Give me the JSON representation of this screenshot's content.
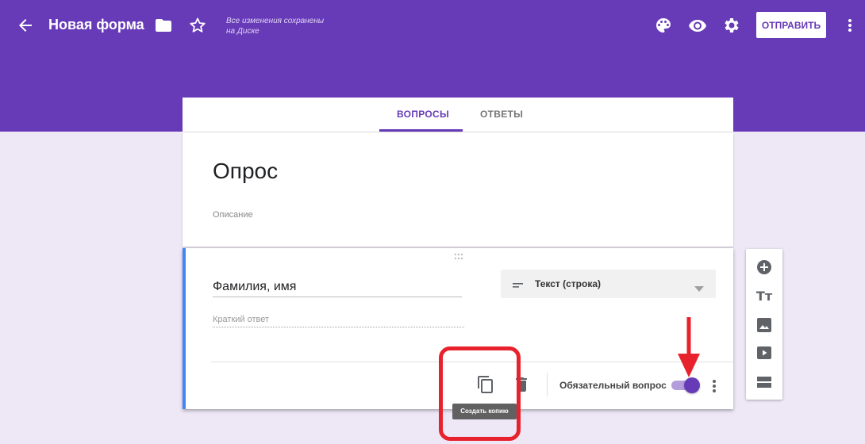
{
  "header": {
    "title": "Новая форма",
    "saved_line1": "Все изменения сохранены",
    "saved_line2": "на Диске",
    "send_label": "ОТПРАВИТЬ",
    "bg_color": "#673ab7",
    "icons": [
      "arrow-back-icon",
      "folder-icon",
      "star-outline-icon",
      "palette-icon",
      "eye-icon",
      "gear-icon",
      "more-vert-icon"
    ]
  },
  "tabs": [
    {
      "label": "ВОПРОСЫ",
      "active": true
    },
    {
      "label": "ОТВЕТЫ",
      "active": false
    }
  ],
  "form": {
    "title": "Опрос",
    "description_placeholder": "Описание"
  },
  "question": {
    "title": "Фамилия, имя",
    "type_label": "Текст (строка)",
    "short_answer_placeholder": "Краткий ответ",
    "required_label": "Обязательный вопрос",
    "required": true,
    "copy_tooltip": "Создать копию"
  },
  "side_toolbar": {
    "icons": [
      "add-circle-icon",
      "title-text-icon",
      "image-icon",
      "video-icon",
      "section-icon"
    ],
    "text_glyph": "Тт"
  },
  "colors": {
    "accent": "#673ab7",
    "background": "#ede7f6",
    "annotation_red": "#e8222d",
    "question_left_border": "#4285f4"
  }
}
